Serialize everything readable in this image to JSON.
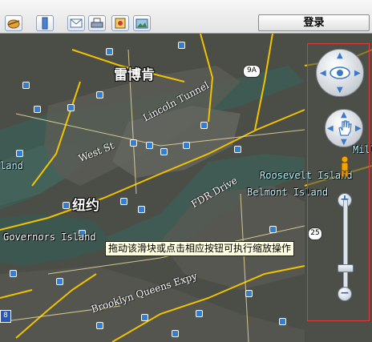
{
  "toolbar": {
    "buttons": [
      {
        "name": "globe-icon"
      },
      {
        "name": "ruler-icon"
      },
      {
        "name": "mail-icon"
      },
      {
        "name": "print-icon"
      },
      {
        "name": "save-image-icon"
      },
      {
        "name": "photo-icon"
      }
    ],
    "login_label": "登录"
  },
  "map": {
    "labels": {
      "harlem": "雷博肯",
      "newyork": "纽约",
      "governors": "Governors Island",
      "roosevelt": "Roosevelt Island",
      "belmont": "Belmont Island",
      "westst": "West St",
      "lincoln": "Lincoln Tunnel",
      "fdr": "FDR Drive",
      "bqe": "Brooklyn Queens Expy",
      "left_island": "land",
      "right_mill": "Mill",
      "shield_9a": "9A",
      "shield_25": "25",
      "shield_278": "8"
    },
    "colors": {
      "water": "#3f5a52",
      "land": "#4a4d45",
      "road_major": "#f2c200",
      "poi": "#2f7fd6"
    }
  },
  "controls": {
    "tooltip": "拖动该滑块或点击相应按钮可执行缩放操作",
    "zoom_in": "+",
    "zoom_out": "−",
    "zoom_level": 0.3
  }
}
